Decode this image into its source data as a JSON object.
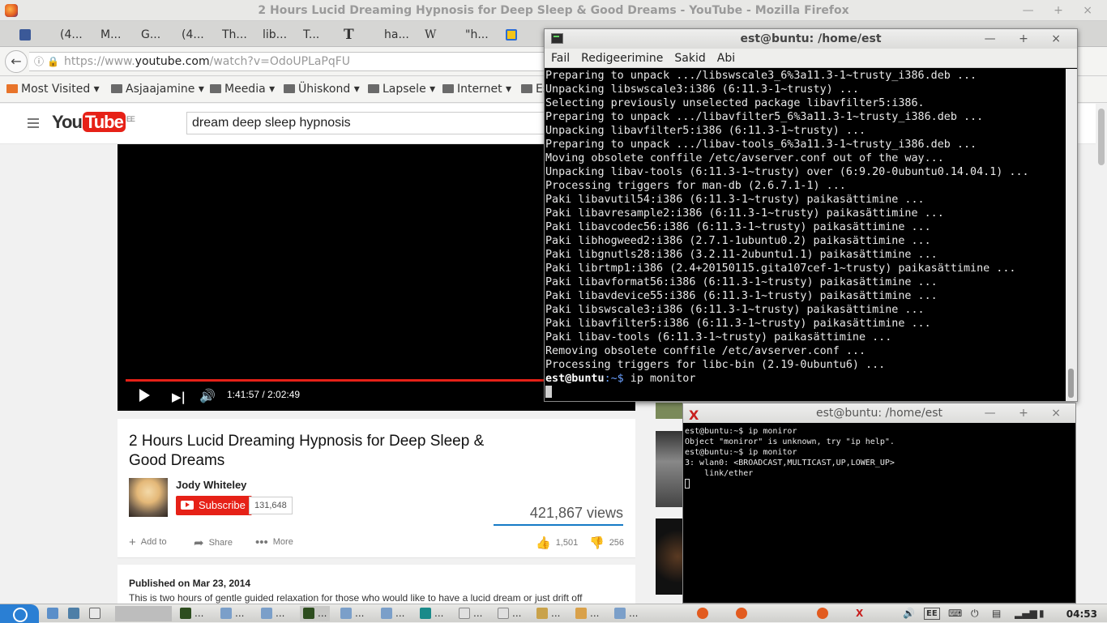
{
  "firefox": {
    "window_title": "2 Hours Lucid Dreaming Hypnosis for Deep Sleep & Good Dreams - YouTube - Mozilla Firefox",
    "window_controls": "— + ×",
    "tabs": [
      {
        "label": "(4...",
        "color": "#3b5998"
      },
      {
        "label": "M...",
        "color": "#ffffff"
      },
      {
        "label": "G...",
        "color": "#ffffff"
      },
      {
        "label": "(4...",
        "color": "#ffffff"
      },
      {
        "label": "Th...",
        "color": "#ffffff"
      },
      {
        "label": "lib...",
        "color": "#ffffff"
      },
      {
        "label": "T...",
        "color": "#ffffff"
      },
      {
        "label": "ha...",
        "color": "#ffffff"
      },
      {
        "label": "\"h...",
        "color": "#ffffff"
      }
    ],
    "nyt_glyph": "T",
    "wiki_glyph": "W",
    "url": {
      "scheme": "https://www.",
      "host": "youtube.com",
      "path": "/watch?v=OdoUPLaPqFU"
    },
    "bookmarks": [
      "Most Visited ▾",
      "Asjaajamine ▾",
      "Meedia ▾",
      "Ühiskond ▾",
      "Lapsele ▾",
      "Internet ▾",
      "Es"
    ]
  },
  "youtube": {
    "logo_you": "You",
    "logo_tube": "Tube",
    "logo_region": "EE",
    "search_value": "dream deep sleep hypnosis",
    "player": {
      "time": "1:41:57 / 2:02:49",
      "progress": 0.83
    },
    "video_title": "2 Hours Lucid Dreaming Hypnosis for Deep Sleep & Good Dreams",
    "channel": "Jody Whiteley",
    "subscribe_label": "Subscribe",
    "subscriber_count": "131,648",
    "views": "421,867 views",
    "actions": {
      "add_to": "Add to",
      "share": "Share",
      "more": "More",
      "likes": "1,501",
      "dislikes": "256"
    },
    "published": "Published on Mar 23, 2014",
    "description": "This is two hours of gentle guided relaxation for those who would like to have a lucid dream or just drift off"
  },
  "terminal1": {
    "title": "est@buntu: /home/est",
    "controls": "— + ×",
    "menu": [
      "Fail",
      "Redigeerimine",
      "Sakid",
      "Abi"
    ],
    "lines": [
      "Preparing to unpack .../libswscale3_6%3a11.3-1~trusty_i386.deb ...",
      "Unpacking libswscale3:i386 (6:11.3-1~trusty) ...",
      "Selecting previously unselected package libavfilter5:i386.",
      "Preparing to unpack .../libavfilter5_6%3a11.3-1~trusty_i386.deb ...",
      "Unpacking libavfilter5:i386 (6:11.3-1~trusty) ...",
      "Preparing to unpack .../libav-tools_6%3a11.3-1~trusty_i386.deb ...",
      "Moving obsolete conffile /etc/avserver.conf out of the way...",
      "Unpacking libav-tools (6:11.3-1~trusty) over (6:9.20-0ubuntu0.14.04.1) ...",
      "Processing triggers for man-db (2.6.7.1-1) ...",
      "Paki libavutil54:i386 (6:11.3-1~trusty) paikasättimine ...",
      "Paki libavresample2:i386 (6:11.3-1~trusty) paikasättimine ...",
      "Paki libavcodec56:i386 (6:11.3-1~trusty) paikasättimine ...",
      "Paki libhogweed2:i386 (2.7.1-1ubuntu0.2) paikasättimine ...",
      "Paki libgnutls28:i386 (3.2.11-2ubuntu1.1) paikasättimine ...",
      "Paki librtmp1:i386 (2.4+20150115.gita107cef-1~trusty) paikasättimine ...",
      "Paki libavformat56:i386 (6:11.3-1~trusty) paikasättimine ...",
      "Paki libavdevice55:i386 (6:11.3-1~trusty) paikasättimine ...",
      "Paki libswscale3:i386 (6:11.3-1~trusty) paikasättimine ...",
      "Paki libavfilter5:i386 (6:11.3-1~trusty) paikasättimine ...",
      "Paki libav-tools (6:11.3-1~trusty) paikasättimine ...",
      "Removing obsolete conffile /etc/avserver.conf ...",
      "Processing triggers for libc-bin (2.19-0ubuntu6) ..."
    ],
    "prompt_user": "est",
    "prompt_at": "@",
    "prompt_host": "buntu",
    "prompt_path": ":~$",
    "command": " ip monitor"
  },
  "terminal2": {
    "title": "est@buntu: /home/est",
    "controls": "— + ×",
    "lines": [
      "est@buntu:~$ ip moniror",
      "Object \"moniror\" is unknown, try \"ip help\".",
      "est@buntu:~$ ip monitor",
      "3: wlan0: <BROADCAST,MULTICAST,UP,LOWER_UP>",
      "    link/ether"
    ]
  },
  "taskbar": {
    "items": [
      "...",
      "...",
      "...",
      "...",
      "...",
      "...",
      "...",
      "...",
      "...",
      "...",
      "...",
      "..."
    ],
    "keyboard_layout": "EE",
    "clock": "04:53"
  }
}
